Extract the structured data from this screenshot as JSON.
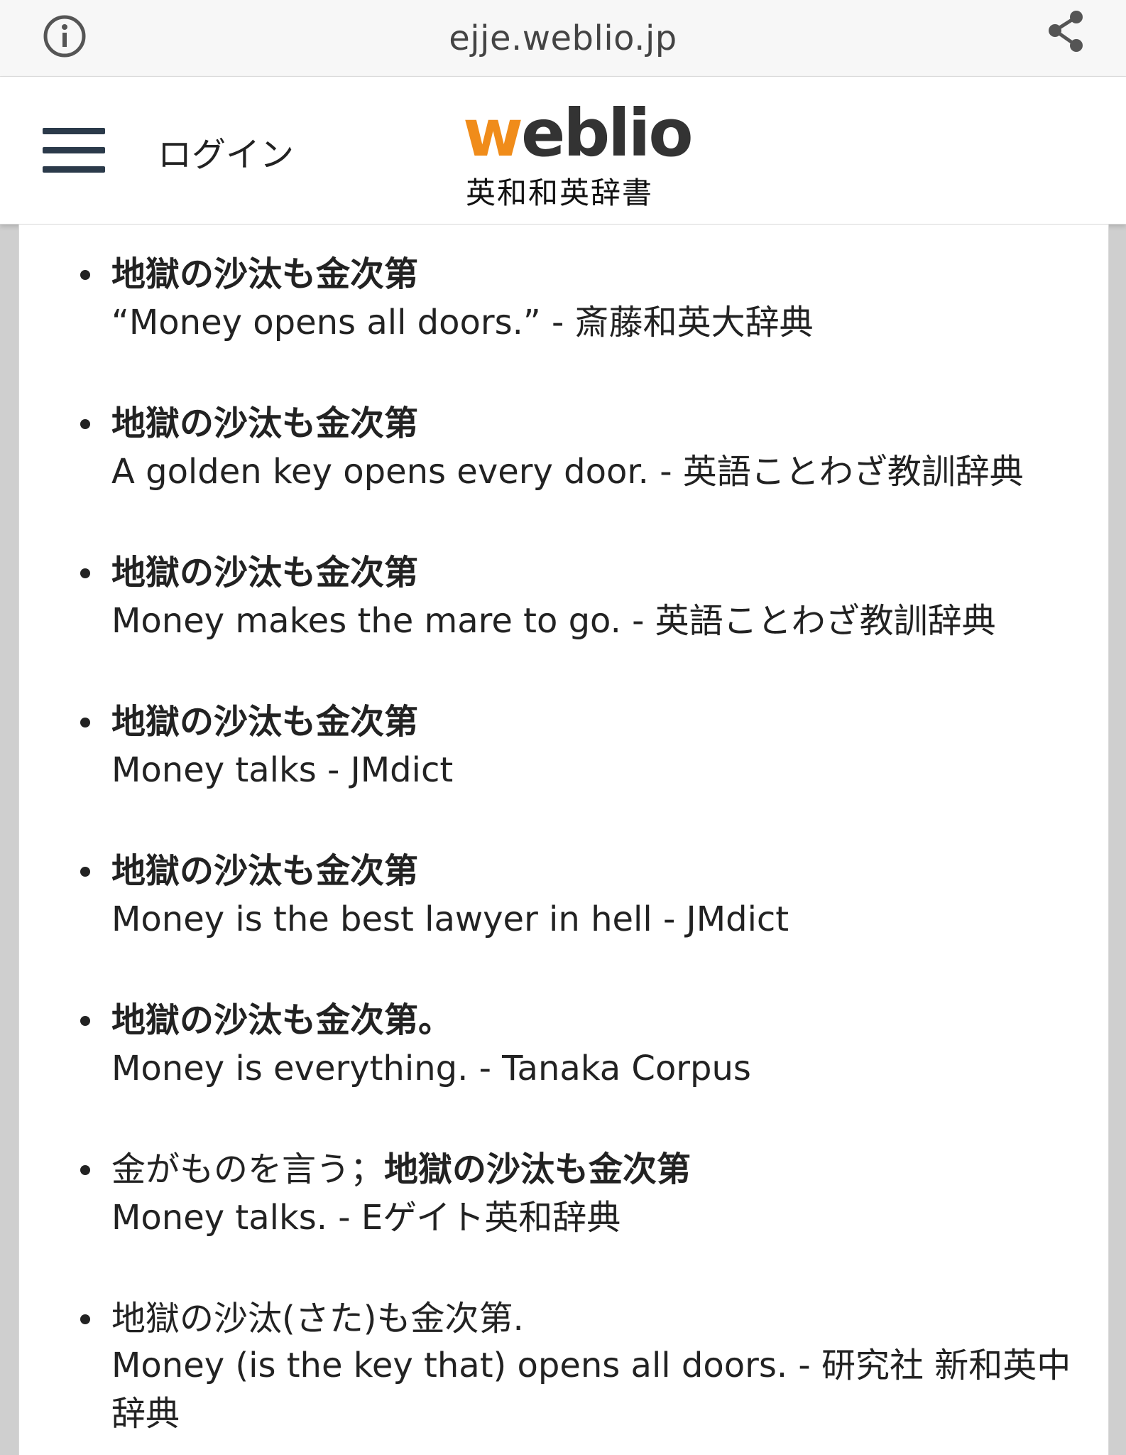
{
  "browser": {
    "url": "ejje.weblio.jp",
    "info_icon": "info-circle-icon",
    "share_icon": "share-icon"
  },
  "header": {
    "menu_icon": "hamburger-menu-icon",
    "login_label": "ログイン",
    "logo_accent": "w",
    "logo_rest": "eblio",
    "logo_subtitle": "英和和英辞書",
    "accent_color": "#f08c1a"
  },
  "examples": [
    {
      "jp": "地獄の沙汰も金次第",
      "en": "“Money opens all doors.” - 斎藤和英大辞典"
    },
    {
      "jp": "地獄の沙汰も金次第",
      "en": "A golden key opens every door. - 英語ことわざ教訓辞典"
    },
    {
      "jp": "地獄の沙汰も金次第",
      "en": "Money makes the mare to go. - 英語ことわざ教訓辞典"
    },
    {
      "jp": "地獄の沙汰も金次第",
      "en": "Money talks - JMdict"
    },
    {
      "jp": "地獄の沙汰も金次第",
      "en": "Money is the best lawyer in hell - JMdict"
    },
    {
      "jp": "地獄の沙汰も金次第。",
      "en": "Money is everything. - Tanaka Corpus"
    },
    {
      "jp_prefix": "金がものを言う；",
      "jp": "地獄の沙汰も金次第",
      "en": "Money talks. - Eゲイト英和辞典"
    },
    {
      "jp": "地獄の沙汰(さた)も金次第.",
      "en": "Money (is the key that) opens all doors. - 研究社 新和英中辞典"
    }
  ]
}
